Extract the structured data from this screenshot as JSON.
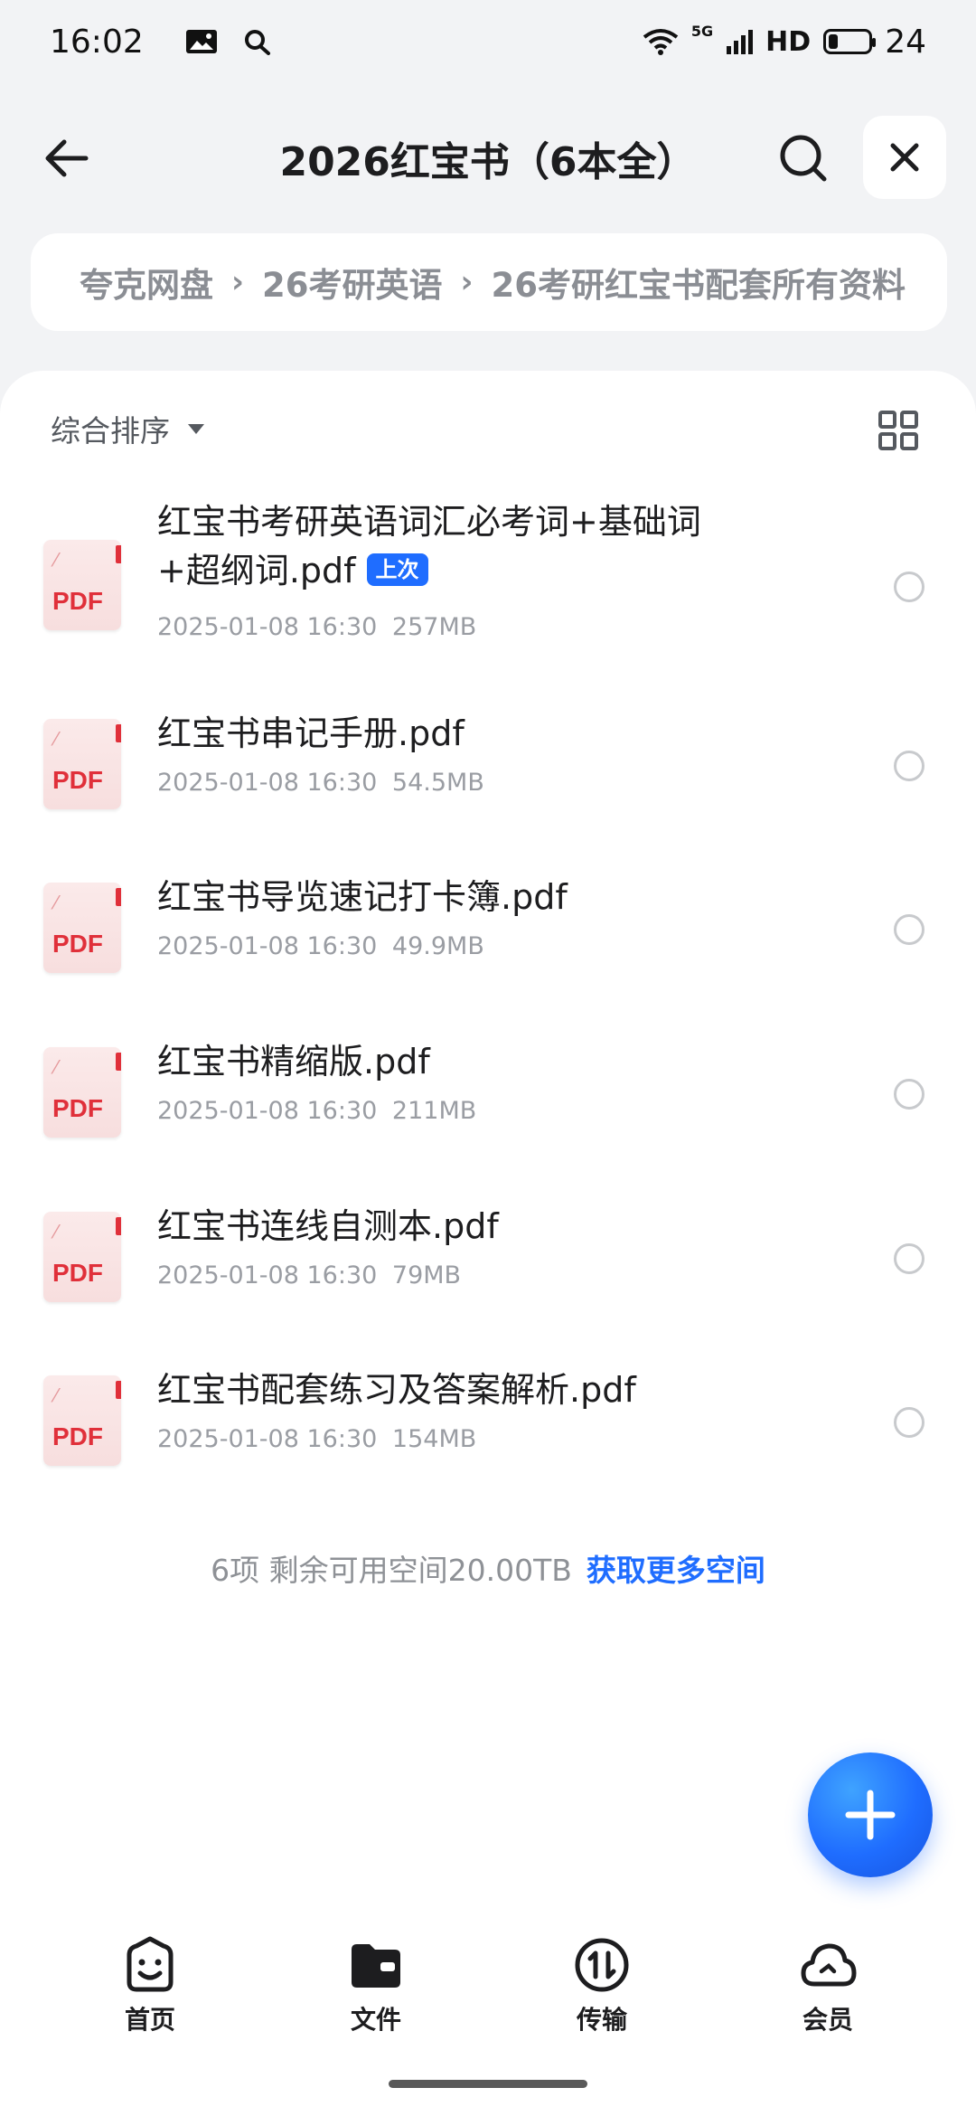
{
  "status_bar": {
    "time": "16:02",
    "network": "5G",
    "hd": "HD",
    "battery_level": "24",
    "battery_fraction": 0.24
  },
  "header": {
    "title": "2026红宝书（6本全）",
    "back_icon": "arrow-left-icon",
    "search_icon": "search-icon",
    "close_icon": "close-icon"
  },
  "breadcrumb": [
    "夸克网盘",
    "26考研英语",
    "26考研红宝书配套所有资料"
  ],
  "sort": {
    "label": "综合排序",
    "view_icon": "grid-view-icon"
  },
  "files": [
    {
      "name": "红宝书考研英语词汇必考词+基础词+超纲词.pdf",
      "badge": "上次",
      "date": "2025-01-08 16:30",
      "size": "257MB",
      "type_label": "PDF"
    },
    {
      "name": "红宝书串记手册.pdf",
      "date": "2025-01-08 16:30",
      "size": "54.5MB",
      "type_label": "PDF"
    },
    {
      "name": "红宝书导览速记打卡簿.pdf",
      "date": "2025-01-08 16:30",
      "size": "49.9MB",
      "type_label": "PDF"
    },
    {
      "name": "红宝书精缩版.pdf",
      "date": "2025-01-08 16:30",
      "size": "211MB",
      "type_label": "PDF"
    },
    {
      "name": "红宝书连线自测本.pdf",
      "date": "2025-01-08 16:30",
      "size": "79MB",
      "type_label": "PDF"
    },
    {
      "name": "红宝书配套练习及答案解析.pdf",
      "date": "2025-01-08 16:30",
      "size": "154MB",
      "type_label": "PDF"
    }
  ],
  "summary": {
    "text": "6项 剩余可用空间20.00TB",
    "link": "获取更多空间"
  },
  "fab_icon": "plus-icon",
  "bottom_nav": [
    {
      "label": "首页",
      "icon": "home-smile-icon"
    },
    {
      "label": "文件",
      "icon": "folder-icon"
    },
    {
      "label": "传输",
      "icon": "transfer-icon"
    },
    {
      "label": "会员",
      "icon": "cloud-icon"
    }
  ],
  "colors": {
    "accent": "#1f6dff",
    "pdf_red": "#e0303a",
    "background": "#f2f3f5"
  }
}
